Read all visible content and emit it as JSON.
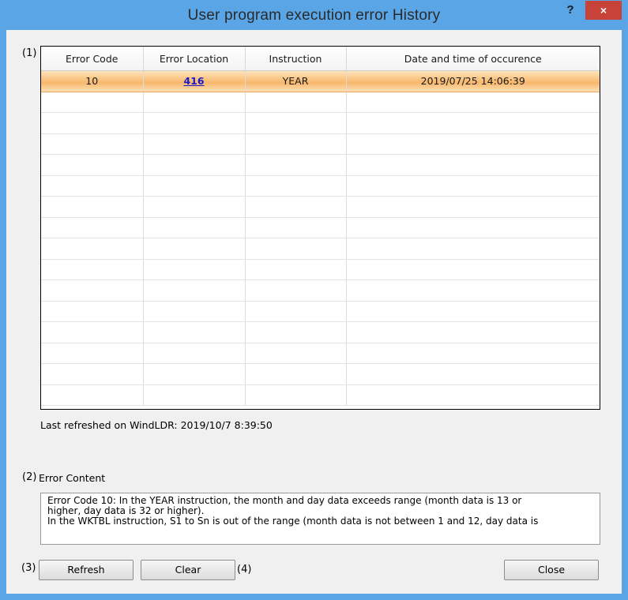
{
  "window": {
    "title": "User program execution error History",
    "help_label": "?",
    "close_label": "×"
  },
  "callouts": {
    "c1": "(1)",
    "c2": "(2)",
    "c3": "(3)",
    "c4": "(4)"
  },
  "grid": {
    "columns": [
      "Error Code",
      "Error Location",
      "Instruction",
      "Date and time of occurence"
    ],
    "rows": [
      {
        "code": "10",
        "location": "416",
        "instruction": "YEAR",
        "datetime": "2019/07/25 14:06:39"
      }
    ],
    "empty_rows": 15
  },
  "status": {
    "last_refreshed": "Last refreshed on WindLDR: 2019/10/7 8:39:50"
  },
  "error_content": {
    "label": "Error Content",
    "line1": "Error Code 10: In the YEAR instruction, the month and day data exceeds range (month data is 13 or",
    "line2": "higher, day data is 32 or higher).",
    "line3": "In the WKTBL instruction, S1 to Sn is out of the range (month data is not between 1 and 12, day data is"
  },
  "buttons": {
    "refresh": "Refresh",
    "clear": "Clear",
    "close": "Close"
  },
  "colors": {
    "titlebar": "#5aa5e6",
    "close_button": "#c7433a",
    "selected_row": "#f8b76b",
    "link": "#1a1acc"
  }
}
